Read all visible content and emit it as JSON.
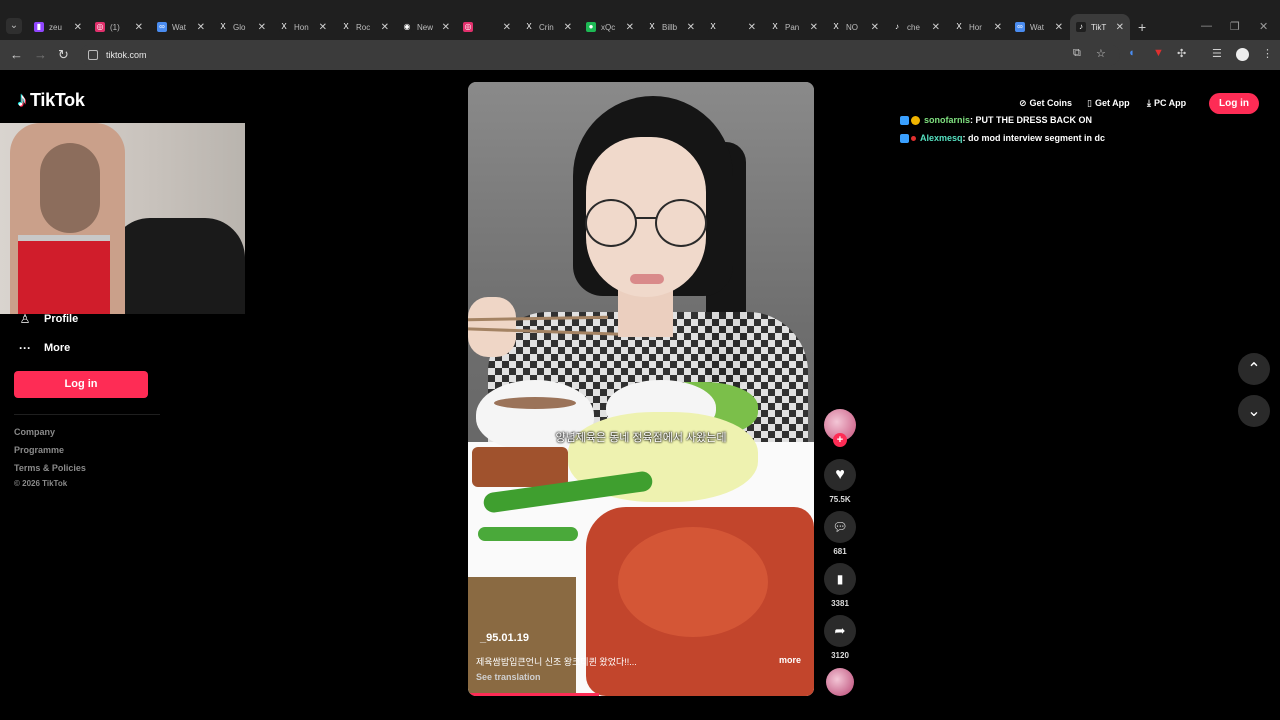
{
  "browser": {
    "tabs": [
      {
        "label": "zeu",
        "icon": "twitch-icon",
        "color": "#9146ff",
        "glyph": "▮"
      },
      {
        "label": "(1)",
        "icon": "instagram-icon",
        "color": "#e1306c",
        "glyph": "◎"
      },
      {
        "label": "Wat",
        "icon": "globe-icon",
        "color": "#4a8cf0",
        "glyph": "∞"
      },
      {
        "label": "Glo",
        "icon": "x-icon",
        "color": "#1f1f1f",
        "glyph": "X"
      },
      {
        "label": "Hon",
        "icon": "x-icon",
        "color": "#1f1f1f",
        "glyph": "X"
      },
      {
        "label": "Roc",
        "icon": "x-icon",
        "color": "#1f1f1f",
        "glyph": "X"
      },
      {
        "label": "New",
        "icon": "github-icon",
        "color": "#1f1f1f",
        "glyph": "◉"
      },
      {
        "label": "",
        "icon": "instagram-icon",
        "color": "#e1306c",
        "glyph": "◎"
      },
      {
        "label": "Crin",
        "icon": "x-icon",
        "color": "#1f1f1f",
        "glyph": "X"
      },
      {
        "label": "xQc",
        "icon": "spotify-icon",
        "color": "#1db954",
        "glyph": "●"
      },
      {
        "label": "Billb",
        "icon": "x-icon",
        "color": "#1f1f1f",
        "glyph": "X"
      },
      {
        "label": "",
        "icon": "x-icon",
        "color": "#1f1f1f",
        "glyph": "X"
      },
      {
        "label": "Pan",
        "icon": "x-icon",
        "color": "#1f1f1f",
        "glyph": "X"
      },
      {
        "label": "NO",
        "icon": "x-icon",
        "color": "#1f1f1f",
        "glyph": "X"
      },
      {
        "label": "che",
        "icon": "tiktok-icon",
        "color": "#1f1f1f",
        "glyph": "♪"
      },
      {
        "label": "Hor",
        "icon": "x-icon",
        "color": "#1f1f1f",
        "glyph": "X"
      },
      {
        "label": "Wat",
        "icon": "globe-icon",
        "color": "#4a8cf0",
        "glyph": "∞"
      },
      {
        "label": "TikT",
        "icon": "tiktok-icon",
        "color": "#1f1f1f",
        "glyph": "♪",
        "active": true
      }
    ],
    "url": "tiktok.com"
  },
  "sidebar": {
    "logo": "TikTok",
    "items": [
      {
        "label": "Profile",
        "icon": "profile-icon"
      },
      {
        "label": "More",
        "icon": "more-icon"
      }
    ],
    "login_label": "Log in",
    "footer_links": [
      "Company",
      "Programme",
      "Terms & Policies"
    ],
    "copyright": "© 2026 TikTok"
  },
  "header": {
    "get_coins": "Get Coins",
    "get_app": "Get App",
    "pc_app": "PC App",
    "login": "Log in"
  },
  "chat": [
    {
      "user": "sonofarnis",
      "message": ": PUT THE DRESS BACK ON",
      "user_color": "#7fe07f",
      "badge_color": "#3aa0ff",
      "badge2_color": "#f0b400"
    },
    {
      "user": "Alexmesq",
      "message": ": do mod interview segment in dc",
      "user_color": "#55e0c0",
      "badge_color": "#3aa0ff",
      "badge2_color": "#e0302f"
    }
  ],
  "video": {
    "subtitle": "양념제육은 동네 정육점에서 사왔는데",
    "author": "_95.01.19",
    "description": "제육쌈밥입큰언니 신조 왕크티퀸 왔었다!!...",
    "more": "more",
    "see_translation": "See translation",
    "progress": 0.38
  },
  "actions": {
    "likes": "75.5K",
    "comments": "681",
    "saves": "3381",
    "shares": "3120"
  }
}
